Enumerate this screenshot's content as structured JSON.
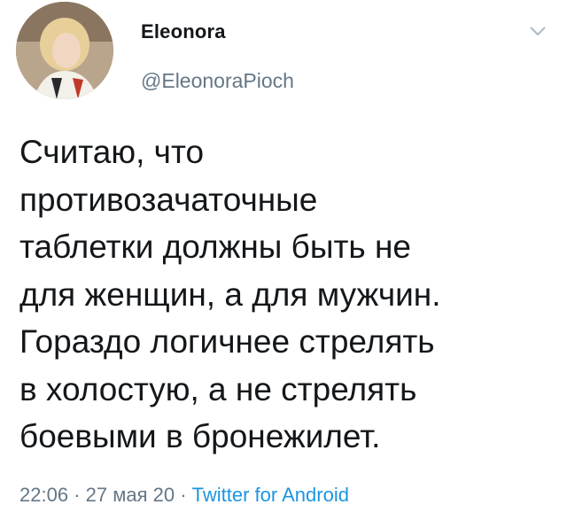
{
  "author": {
    "name": "Eleonora",
    "handle": "@EleonoraPioch"
  },
  "tweet": {
    "text": "Считаю, что\nпротивозачаточные\nтаблетки должны быть не\nдля женщин,  а для мужчин.\nГораздо логичнее стрелять\nв холостую, а не стрелять\nбоевыми в бронежилет."
  },
  "meta": {
    "time": "22:06",
    "separator1": " · ",
    "date": "27 мая 20",
    "separator2": " · ",
    "source": "Twitter for Android"
  },
  "icons": {
    "menu": "chevron-down-icon",
    "avatar": "avatar"
  },
  "colors": {
    "text": "#14171a",
    "secondary": "#657786",
    "link": "#1b95e0"
  }
}
